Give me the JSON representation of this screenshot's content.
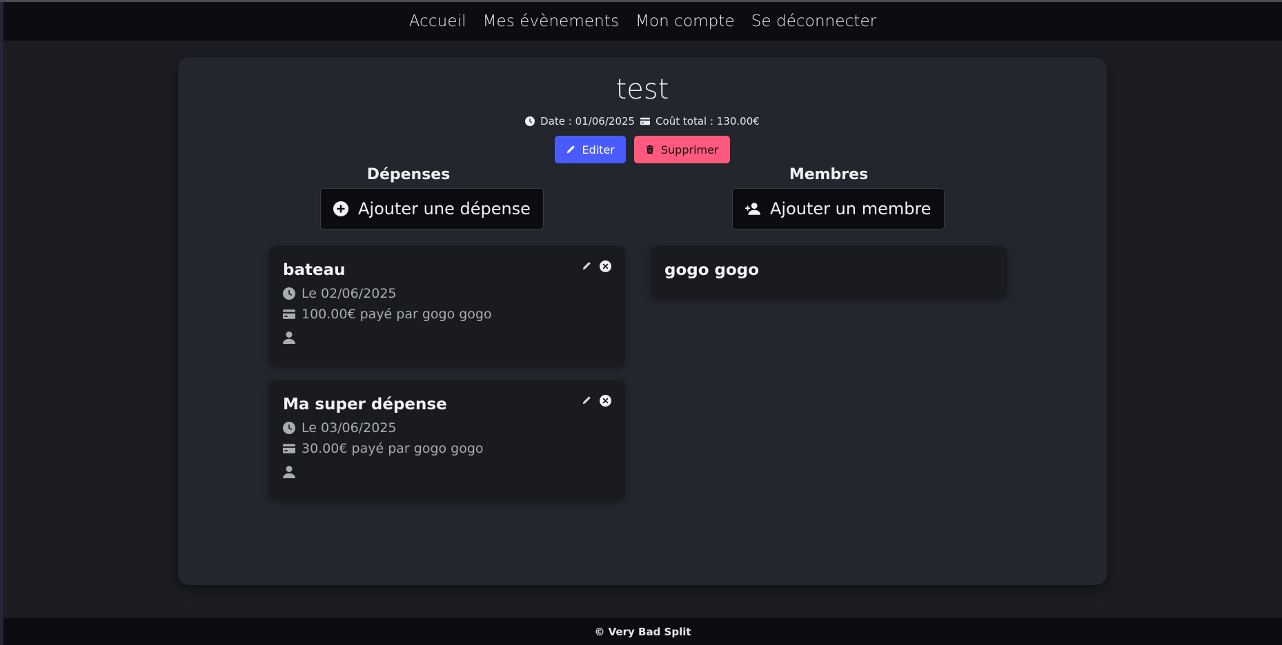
{
  "nav": {
    "items": [
      {
        "label": "Accueil"
      },
      {
        "label": "Mes évènements"
      },
      {
        "label": "Mon compte"
      },
      {
        "label": "Se déconnecter"
      }
    ]
  },
  "event": {
    "title": "test",
    "date_text": "Date : 01/06/2025",
    "total_text": "Coût total : 130.00€",
    "edit_label": "Editer",
    "delete_label": "Supprimer"
  },
  "expenses": {
    "title": "Dépenses",
    "add_label": "Ajouter une dépense",
    "items": [
      {
        "name": "bateau",
        "date": "Le 02/06/2025",
        "amount": "100.00€ payé par gogo gogo"
      },
      {
        "name": "Ma super dépense",
        "date": "Le 03/06/2025",
        "amount": "30.00€ payé par gogo gogo"
      }
    ]
  },
  "members": {
    "title": "Membres",
    "add_label": "Ajouter un membre",
    "items": [
      {
        "name": "gogo gogo"
      }
    ]
  },
  "footer": {
    "text": "© Very Bad Split"
  },
  "colors": {
    "background": "#1b1d22",
    "card": "#23262d",
    "edit_button": "#4a5cff",
    "delete_button": "#ff5a7e"
  }
}
